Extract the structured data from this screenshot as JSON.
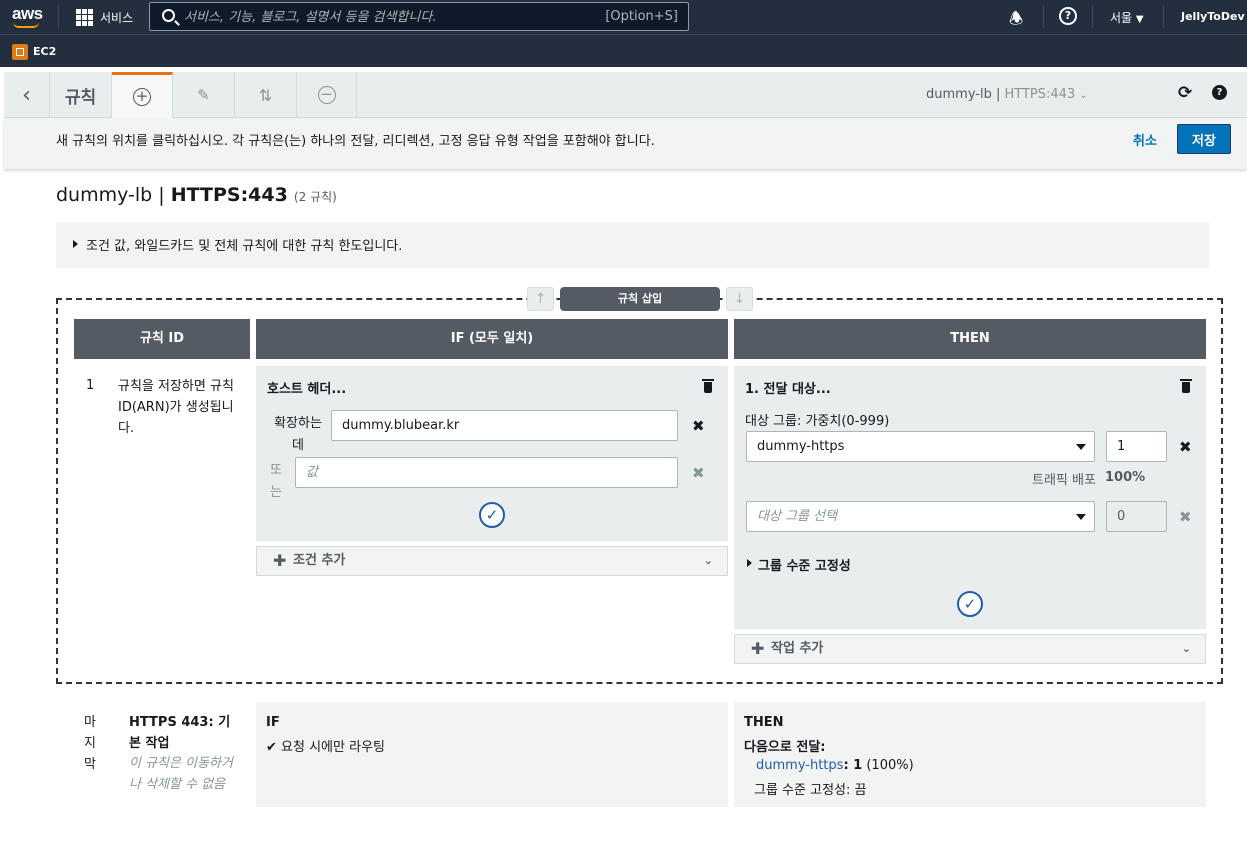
{
  "topnav": {
    "logo": "aws",
    "services_label": "서비스",
    "search_placeholder": "서비스, 기능, 블로그, 설명서 등을 검색합니다.",
    "search_shortcut": "[Option+S]",
    "region": "서울",
    "user": "JellyToDev"
  },
  "breadcrumb": {
    "service": "EC2"
  },
  "toolbar": {
    "rules_label": "규칙",
    "context": "dummy-lb",
    "listener": "HTTPS:443"
  },
  "info_bar": {
    "message": "새 규칙의 위치를 클릭하십시오. 각 규칙은(는) 하나의 전달, 리디렉션, 고정 응답 유형 작업을 포함해야 합니다.",
    "cancel": "취소",
    "save": "저장"
  },
  "page": {
    "lb_name": "dummy-lb",
    "listener": "HTTPS:443",
    "rule_count": "(2 규칙)",
    "limits_text": "조건 값, 와일드카드 및 전체 규칙에 대한 규칙 한도입니다."
  },
  "insert": {
    "label": "규칙 삽입",
    "up": "↑",
    "down": "↓"
  },
  "columns": {
    "rule_id": "규칙 ID",
    "if": "IF (모두 일치)",
    "then": "THEN"
  },
  "rule": {
    "number": "1",
    "id_note": "규칙을 저장하면 규칙 ID(ARN)가 생성됩니다.",
    "condition": {
      "title": "호스트 헤더...",
      "is_label": "확장하는 데",
      "value": "dummy.blubear.kr",
      "or_label": "또는",
      "value_placeholder": "값"
    },
    "add_condition": "조건 추가",
    "action": {
      "title": "1. 전달 대상...",
      "tg_label": "대상 그룹: 가중치(0-999)",
      "tg1": "dummy-https",
      "weight1": "1",
      "traffic_label": "트래픽 배포",
      "traffic_pct": "100%",
      "tg2_placeholder": "대상 그룹 선택",
      "weight2": "0",
      "stickiness": "그룹 수준 고정성"
    },
    "add_action": "작업 추가"
  },
  "default_rule": {
    "label": "마지막",
    "title": "HTTPS 443: 기본 작업",
    "note": "이 규칙은 이동하거나 삭제할 수 없음",
    "if_title": "IF",
    "if_text": "요청 시에만 라우팅",
    "then_title": "THEN",
    "then_forward": "다음으로 전달:",
    "then_tg": "dummy-https",
    "then_weight": ": 1",
    "then_pct": "(100%)",
    "then_stickiness": "그룹 수준 고정성: 끔"
  }
}
